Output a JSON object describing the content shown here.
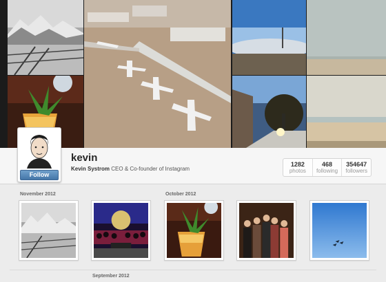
{
  "profile": {
    "username": "kevin",
    "full_name": "Kevin Systrom",
    "bio": "CEO & Co-founder of Instagram",
    "follow_label": "Follow"
  },
  "stats": [
    {
      "value": "1282",
      "label": "photos"
    },
    {
      "value": "468",
      "label": "following"
    },
    {
      "value": "354647",
      "label": "followers"
    }
  ],
  "feed": {
    "months": [
      "November 2012",
      "October 2012",
      "September 2012"
    ]
  },
  "colors": {
    "follow_button": "#4a7aac",
    "page_background": "#ececec",
    "profile_bar": "#f6f6f6"
  }
}
